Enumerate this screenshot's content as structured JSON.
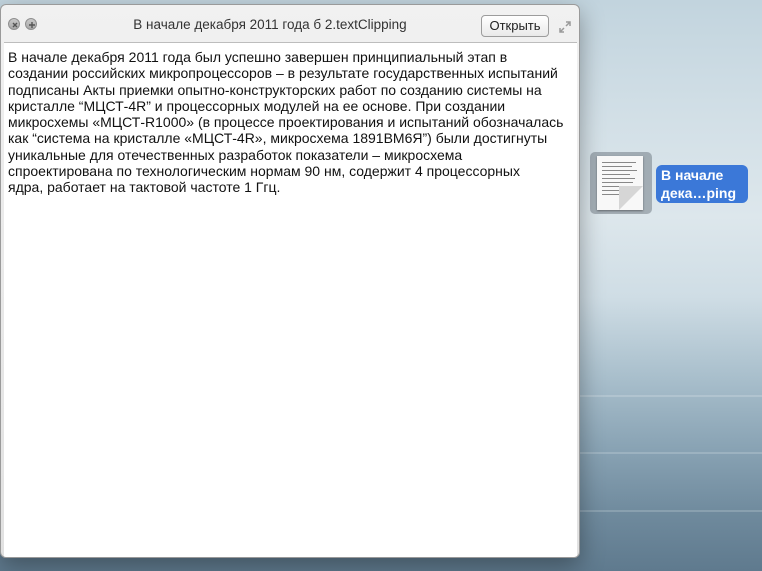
{
  "window": {
    "title": "В начале декабря 2011 года б 2.textClipping",
    "open_button": "Открыть",
    "icons": [
      "close-icon",
      "add-icon",
      "fullscreen-icon"
    ]
  },
  "clipping": {
    "lines": [
      "В начале декабря 2011 года был успешно завершен принципиальный этап в",
      "создании российских микропроцессоров – в результате государственных испытаний",
      "подписаны Акты приемки опытно-конструкторских работ по созданию системы на",
      "кристалле “МЦСТ-4R” и процессорных модулей на ее основе. При создании",
      "микросхемы «МЦСТ-R1000» (в процессе проектирования и испытаний обозначалась",
      "как “система на кристалле «МЦСТ-4R», микросхема 1891ВМ6Я”) были достигнуты",
      "уникальные для отечественных разработок показатели – микросхема",
      "спроектирована по технологическим нормам 90 нм, содержит 4 процессорных",
      "ядра, работает на тактовой частоте 1 Ггц."
    ]
  },
  "desktop": {
    "file_label_line1": "В начале",
    "file_label_line2": "дека…ping"
  },
  "colors": {
    "selection": "#3b78d8",
    "window_bg": "#ececec"
  }
}
